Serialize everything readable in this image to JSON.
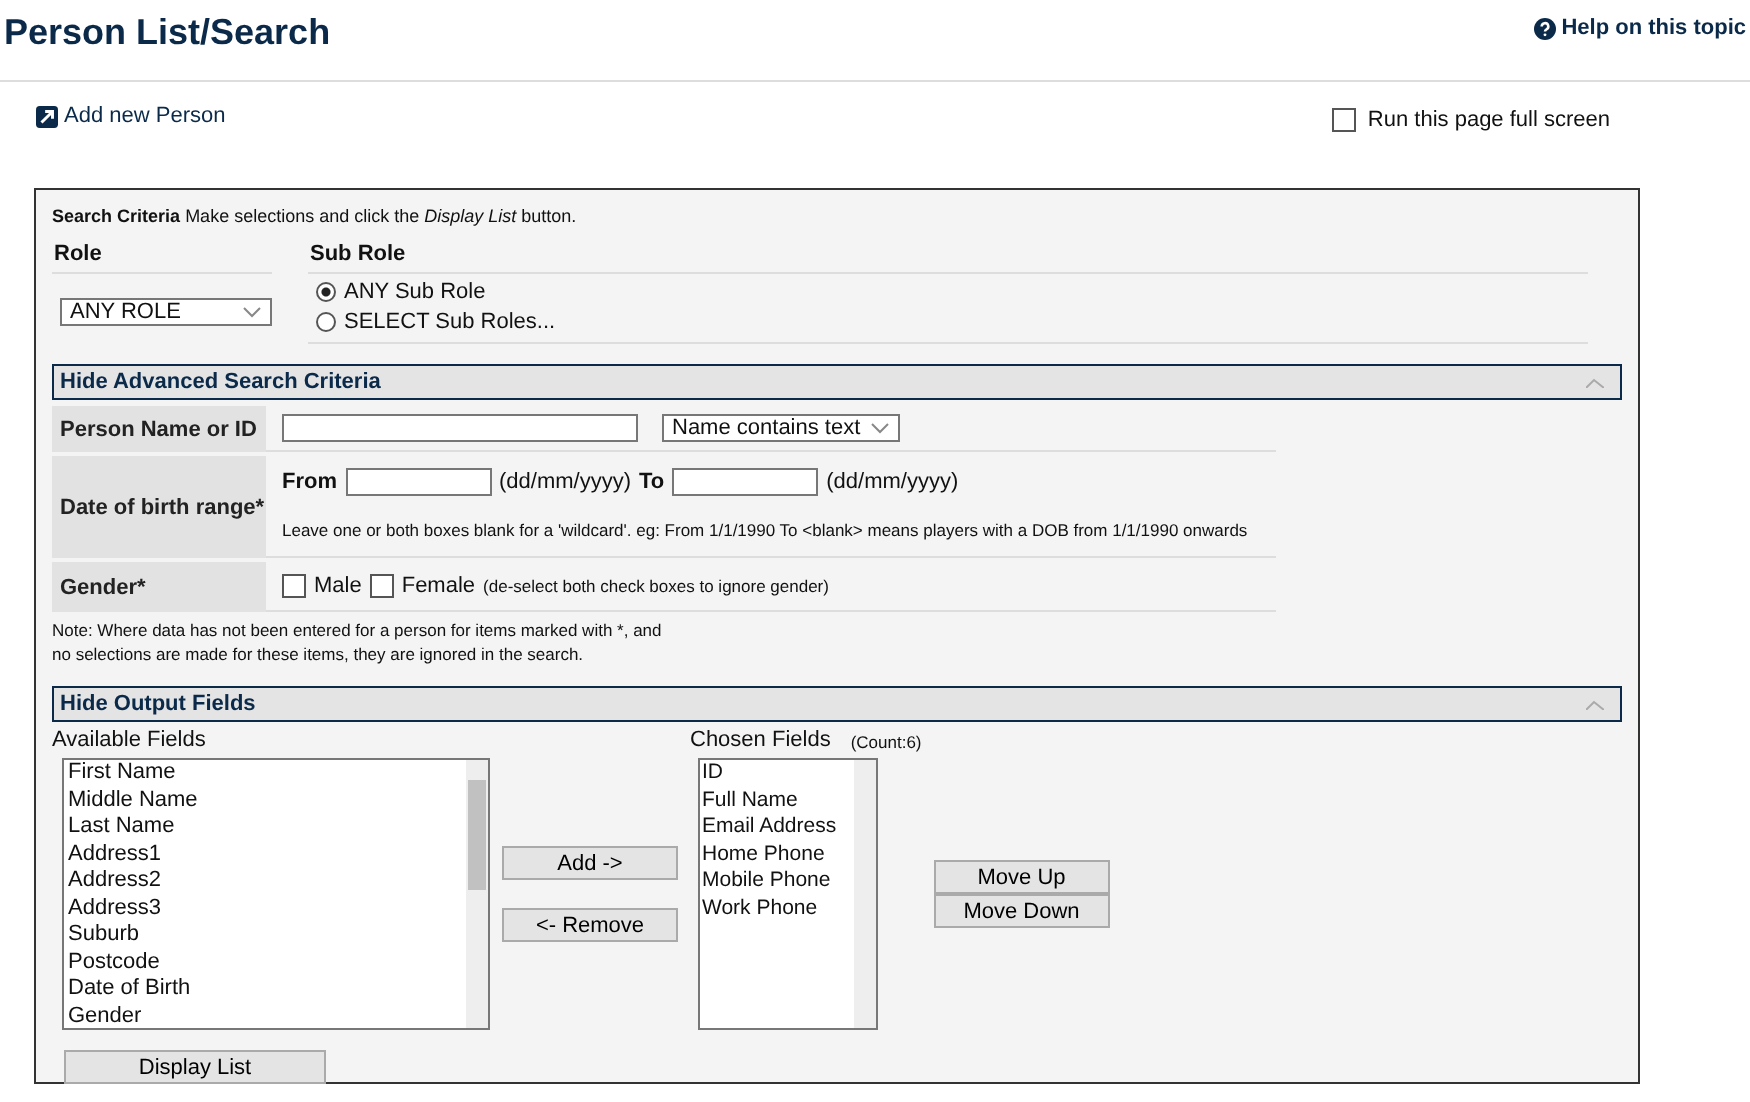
{
  "header": {
    "title": "Person List/Search",
    "help_link": "Help on this topic"
  },
  "add_link": "Add new Person",
  "full_screen": {
    "label": "Run this page full screen",
    "checked": false
  },
  "search_criteria": {
    "heading": "Search Criteria",
    "instruction": "Make selections and click the *Display List* button."
  },
  "role": {
    "label": "Role",
    "value": "ANY ROLE"
  },
  "sub_role": {
    "label": "Sub Role",
    "options": [
      {
        "label": "ANY Sub Role",
        "selected": true
      },
      {
        "label": "SELECT Sub Roles...",
        "selected": false
      }
    ]
  },
  "advanced": {
    "heading": "Hide Advanced Search Criteria",
    "name_label": "Person Name or ID",
    "name_mode": "Name contains text",
    "dob_label": "Date of birth range*",
    "from_label": "From",
    "date_hint_from": "(dd/mm/yyyy)",
    "to_label": "To",
    "date_hint_to": "(dd/mm/yyyy)",
    "dob_note": "Leave one or both boxes blank for a 'wildcard'. eg: From 1/1/1990 To <blank> means players with a DOB from 1/1/1990 onwards",
    "gender_label": "Gender*",
    "genders": [
      {
        "label": "Male",
        "checked": false
      },
      {
        "label": "Female",
        "checked": false
      }
    ],
    "gender_note": "(de-select both check boxes to ignore gender)",
    "note_lines": [
      "Note: Where data has not been entered for a person for items marked with *, and",
      "no selections are made for these items, they are ignored in the search."
    ]
  },
  "output": {
    "heading": "Hide Output Fields",
    "available_label": "Available Fields",
    "available_fields": [
      "First Name",
      "Middle Name",
      "Last Name",
      "Address1",
      "Address2",
      "Address3",
      "Suburb",
      "Postcode",
      "Date of Birth",
      "Gender"
    ],
    "add_button": "Add ->",
    "remove_button": "<- Remove",
    "chosen_label": "Chosen Fields",
    "chosen_count": "(Count:6)",
    "chosen_fields": [
      "ID",
      "Full Name",
      "Email Address",
      "Home Phone",
      "Mobile Phone",
      "Work Phone"
    ],
    "move_up_button": "Move Up",
    "move_down_button": "Move Down"
  },
  "display_button": "Display List"
}
